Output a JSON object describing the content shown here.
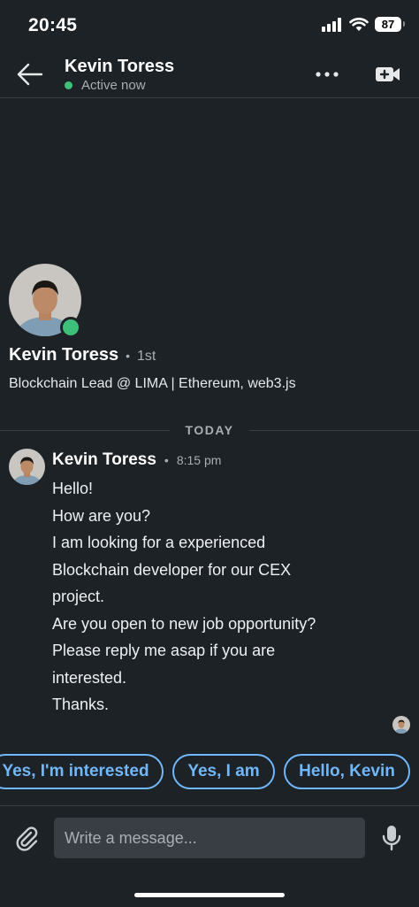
{
  "status_bar": {
    "time": "20:45",
    "battery": "87",
    "icons": [
      "cellular-signal-icon",
      "wifi-icon",
      "battery-icon"
    ]
  },
  "header": {
    "name": "Kevin Toress",
    "status": "Active now",
    "icons": [
      "back-arrow-icon",
      "more-icon",
      "video-call-icon"
    ]
  },
  "profile": {
    "name": "Kevin Toress",
    "degree": "1st",
    "headline": "Blockchain Lead @ LIMA | Ethereum, web3.js"
  },
  "divider": {
    "label": "TODAY"
  },
  "message": {
    "sender": "Kevin Toress",
    "time": "8:15 pm",
    "lines": [
      "Hello!",
      "How are you?",
      "I am looking for a experienced",
      "Blockchain developer for our CEX",
      "project.",
      "Are you open to new job opportunity?",
      "Please reply me asap if you are",
      "interested.",
      "Thanks."
    ]
  },
  "smart_replies": [
    "Yes, I'm interested",
    "Yes, I am",
    "Hello, Kevin"
  ],
  "composer": {
    "placeholder": "Write a message...",
    "icons": [
      "paperclip-icon",
      "microphone-icon"
    ]
  },
  "colors": {
    "background": "#1d2226",
    "accent": "#71b7fb",
    "presence": "#3cc07a",
    "input_background": "#383e43",
    "muted_text": "#a8aeb3"
  }
}
